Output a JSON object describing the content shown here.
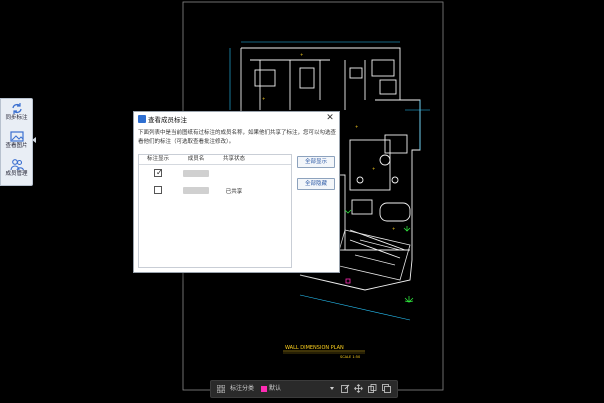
{
  "left_palette": {
    "items": [
      {
        "label": "同步标注",
        "icon": "sync-icon"
      },
      {
        "label": "查看图片",
        "icon": "image-icon"
      },
      {
        "label": "成员管理",
        "icon": "members-icon"
      }
    ]
  },
  "dialog": {
    "title": "查看成员标注",
    "description": "下面列表中是当前图纸有过标注的成员名称，如果他们共享了标注，您可以勾选查看他们的标注（可选取查看批注修改）。",
    "columns": [
      "标注显示",
      "成员名",
      "共享状态"
    ],
    "rows": [
      {
        "visible": true,
        "member": "",
        "status": ""
      },
      {
        "visible": false,
        "member": "",
        "status": "已共享"
      }
    ],
    "buttons": {
      "show_all": "全部显示",
      "hide_all": "全部隐藏"
    },
    "close_icon": "close-icon"
  },
  "drawing": {
    "plan_title": "WALL DIMENSION PLAN",
    "scale_text": "SCALE 1:50",
    "accent_colors": {
      "line": "#f5f5f5",
      "dim": "#28c8ff",
      "text": "#ffd21e",
      "green": "#2ee23c",
      "magenta": "#ff2bb4"
    }
  },
  "bottom_toolbar": {
    "label": "标注分类",
    "category": "默认",
    "category_color": "#ff2bb4",
    "tools": [
      "edit-icon",
      "move-icon",
      "copy-icon",
      "layers-icon"
    ]
  }
}
